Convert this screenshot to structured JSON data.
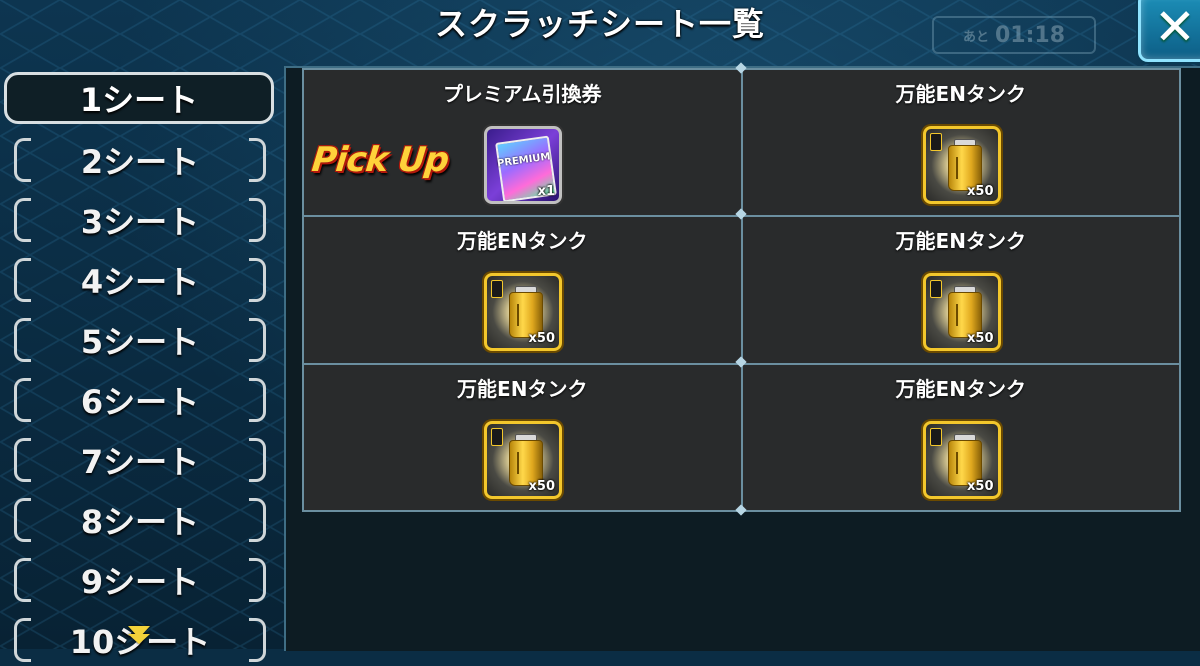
{
  "header": {
    "title": "スクラッチシート一覧",
    "close_label": "✕"
  },
  "background": {
    "timer_prefix": "あと",
    "timer_value": "01:18"
  },
  "sidebar": {
    "tabs": [
      {
        "label": "1シート",
        "active": true
      },
      {
        "label": "2シート",
        "active": false
      },
      {
        "label": "3シート",
        "active": false
      },
      {
        "label": "4シート",
        "active": false
      },
      {
        "label": "5シート",
        "active": false
      },
      {
        "label": "6シート",
        "active": false
      },
      {
        "label": "7シート",
        "active": false
      },
      {
        "label": "8シート",
        "active": false
      },
      {
        "label": "9シート",
        "active": false
      },
      {
        "label": "10シート",
        "active": false
      }
    ]
  },
  "prizes": [
    {
      "name": "プレミアム引換券",
      "quantity": "x1",
      "icon": "premium-ticket-icon",
      "pickup_label": "Pick Up"
    },
    {
      "name": "万能ENタンク",
      "quantity": "x50",
      "icon": "en-tank-icon"
    },
    {
      "name": "万能ENタンク",
      "quantity": "x50",
      "icon": "en-tank-icon"
    },
    {
      "name": "万能ENタンク",
      "quantity": "x50",
      "icon": "en-tank-icon"
    },
    {
      "name": "万能ENタンク",
      "quantity": "x50",
      "icon": "en-tank-icon"
    },
    {
      "name": "万能ENタンク",
      "quantity": "x50",
      "icon": "en-tank-icon"
    }
  ],
  "colors": {
    "accent_gold": "#f3c72c",
    "pickup_text": "#ffd23a",
    "close_button": "#1c8fb8"
  }
}
